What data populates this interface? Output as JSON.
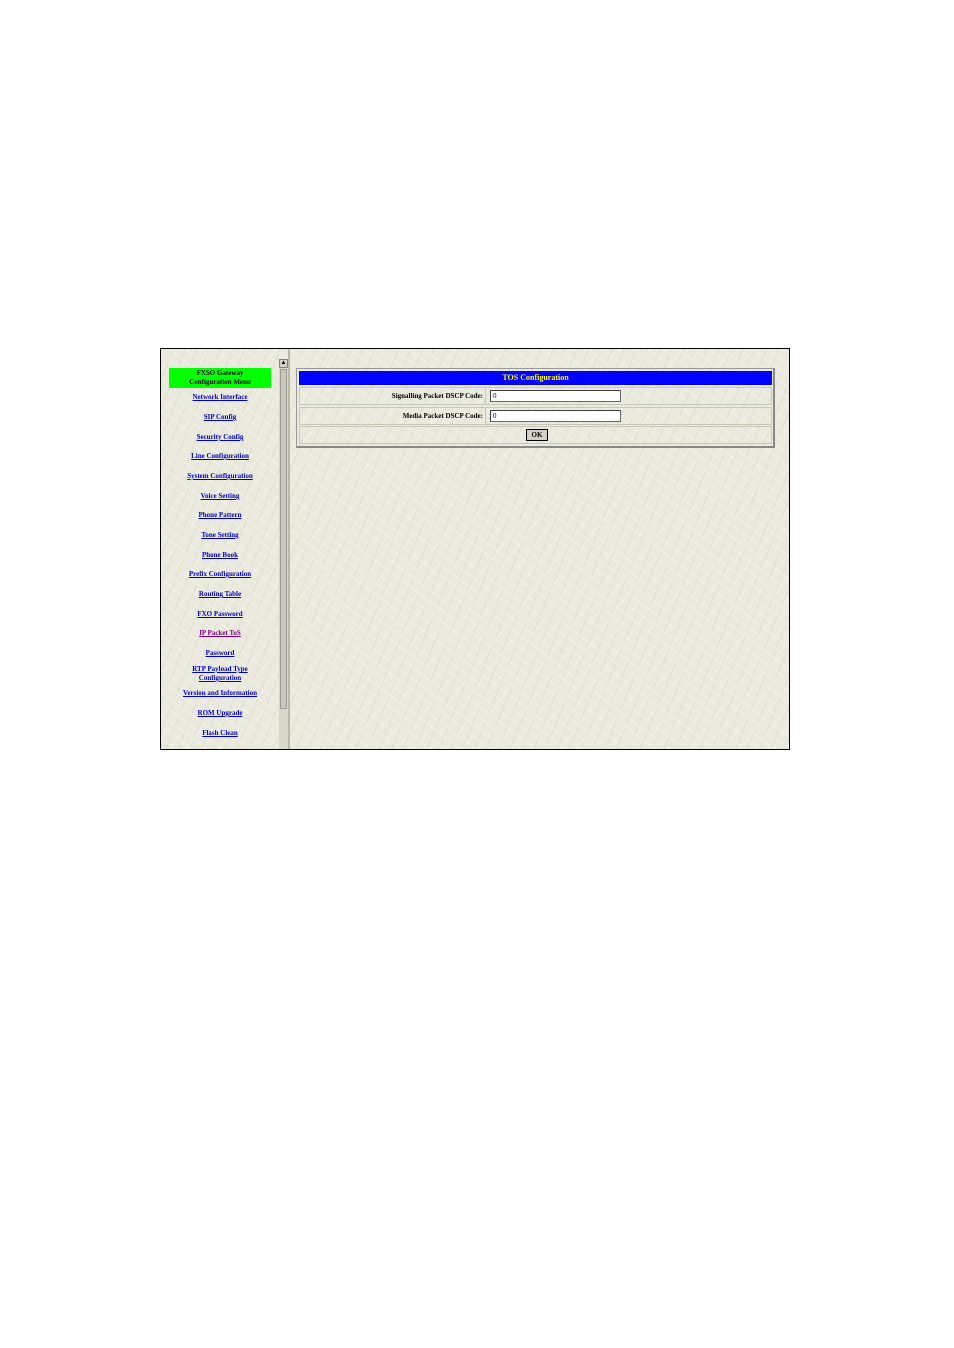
{
  "sidebar": {
    "title_line1": "FXSO Gateway",
    "title_line2": "Configuration Menu",
    "items": [
      {
        "label": "Network Interface"
      },
      {
        "label": "SIP Config"
      },
      {
        "label": "Security Config"
      },
      {
        "label": "Line Configuration"
      },
      {
        "label": "System Configuration"
      },
      {
        "label": "Voice Setting"
      },
      {
        "label": "Phone Pattern"
      },
      {
        "label": "Tone Setting"
      },
      {
        "label": "Phone Book"
      },
      {
        "label": "Prefix Configuration"
      },
      {
        "label": "Routing Table"
      },
      {
        "label": "FXO Password"
      },
      {
        "label": "IP Packet ToS"
      },
      {
        "label": "Password"
      },
      {
        "label": "RTP Payload Type",
        "label2": "Configuration"
      },
      {
        "label": "Version and Information"
      },
      {
        "label": "ROM Upgrade"
      },
      {
        "label": "Flash Clean"
      }
    ]
  },
  "panel": {
    "header": "TOS Configuration",
    "fields": [
      {
        "label": "Signalling Packet DSCP Code:",
        "value": "0"
      },
      {
        "label": "Media Packet DSCP Code:",
        "value": "0"
      }
    ],
    "ok_label": "OK"
  },
  "colors": {
    "menu_title_bg": "#00ff00",
    "header_bg": "#0000ff",
    "header_text": "#ffff00",
    "link": "#0000cc",
    "visited_link": "#800080"
  }
}
